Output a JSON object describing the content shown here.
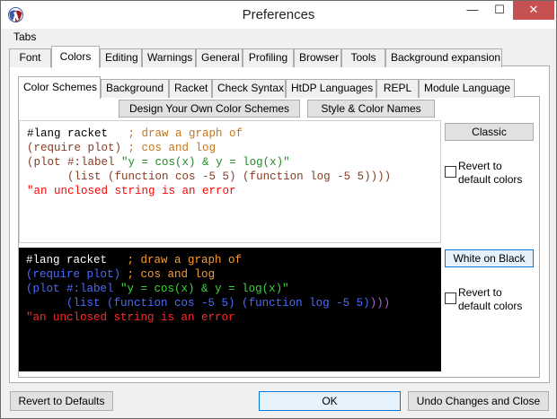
{
  "window": {
    "title": "Preferences"
  },
  "titlebar": {
    "min": "—",
    "max": "☐",
    "close": "✕"
  },
  "menu": {
    "tabs": "Tabs"
  },
  "top_tabs": [
    "Font",
    "Colors",
    "Editing",
    "Warnings",
    "General",
    "Profiling",
    "Browser",
    "Tools",
    "Background expansion"
  ],
  "sub_tabs": [
    "Color Schemes",
    "Background",
    "Racket",
    "Check Syntax",
    "HtDP Languages",
    "REPL",
    "Module Language"
  ],
  "actions": {
    "design": "Design Your Own Color Schemes",
    "style": "Style & Color Names"
  },
  "schemes": {
    "classic": {
      "button": "Classic",
      "revert_1": "Revert to",
      "revert_2": "default colors"
    },
    "wob": {
      "button": "White on Black",
      "revert_1": "Revert to",
      "revert_2": "default colors"
    }
  },
  "code": {
    "l1_lang": "#lang racket   ",
    "l1_cm": "; draw a graph of",
    "l2_open": "(",
    "l2_kw": "require plot",
    "l2_close": ")",
    "l2_cm": " ; cos and log",
    "l3_open": "(",
    "l3_kw": "plot #:label ",
    "l3_st": "\"y = cos(x) & y = log(x)\"",
    "l4_pre": "      ",
    "l4_open": "(",
    "l4_kw": "list (function cos -5 5) (function log -5 5)",
    "l4_close": ")))",
    "l5_err": "\"an unclosed string is an error"
  },
  "bottom": {
    "revert": "Revert to Defaults",
    "ok": "OK",
    "undo": "Undo Changes and Close"
  },
  "colors": {
    "close_button": "#c75050",
    "focus": "#0078d7",
    "dark_bg": "#000000"
  }
}
